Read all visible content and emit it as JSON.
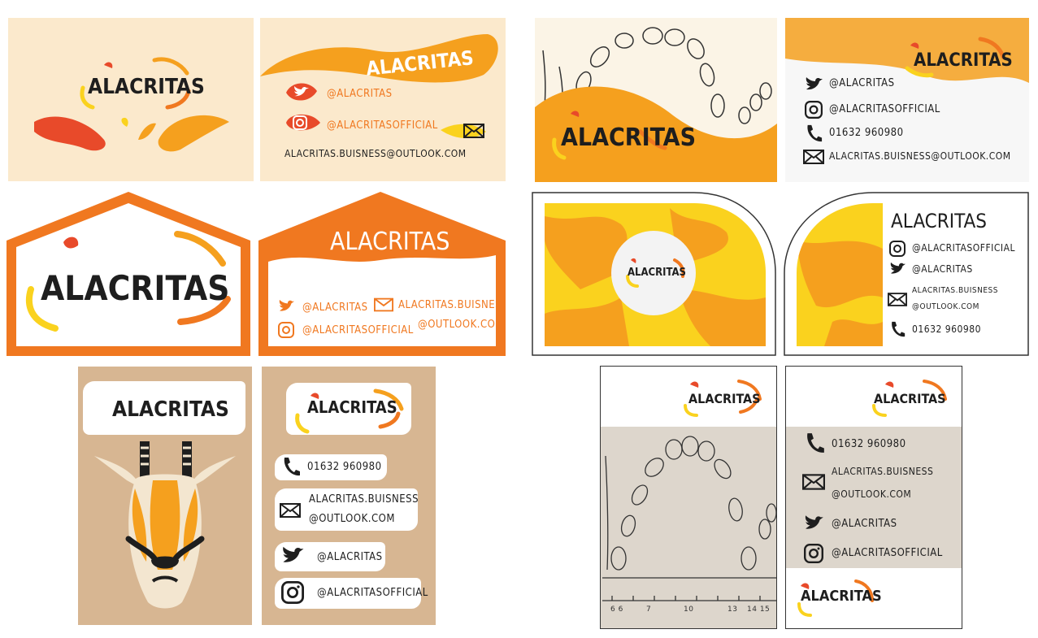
{
  "brand": "ALACRITAS",
  "twitter": "@ALACRITAS",
  "instagram": "@ALACRITASOFFICIAL",
  "email": "ALACRITAS.BUISNESS@OUTLOOK.COM",
  "email_line1": "ALACRITAS.BUISNESS",
  "email_line2": "@OUTLOOK.COM",
  "phone": "01632 960980",
  "ruler_labels": [
    "6 6",
    "7",
    "10",
    "13",
    "14 15"
  ],
  "colors": {
    "cream": "#fbe9cc",
    "orange": "#f5a01e",
    "deep_orange": "#f07820",
    "red": "#e84a2a",
    "yellow": "#fad21e",
    "tan": "#d7b692",
    "grey": "#ddd6cc",
    "dark": "#1e1e1e"
  },
  "icons": [
    "twitter-icon",
    "instagram-icon",
    "mail-icon",
    "phone-icon"
  ]
}
